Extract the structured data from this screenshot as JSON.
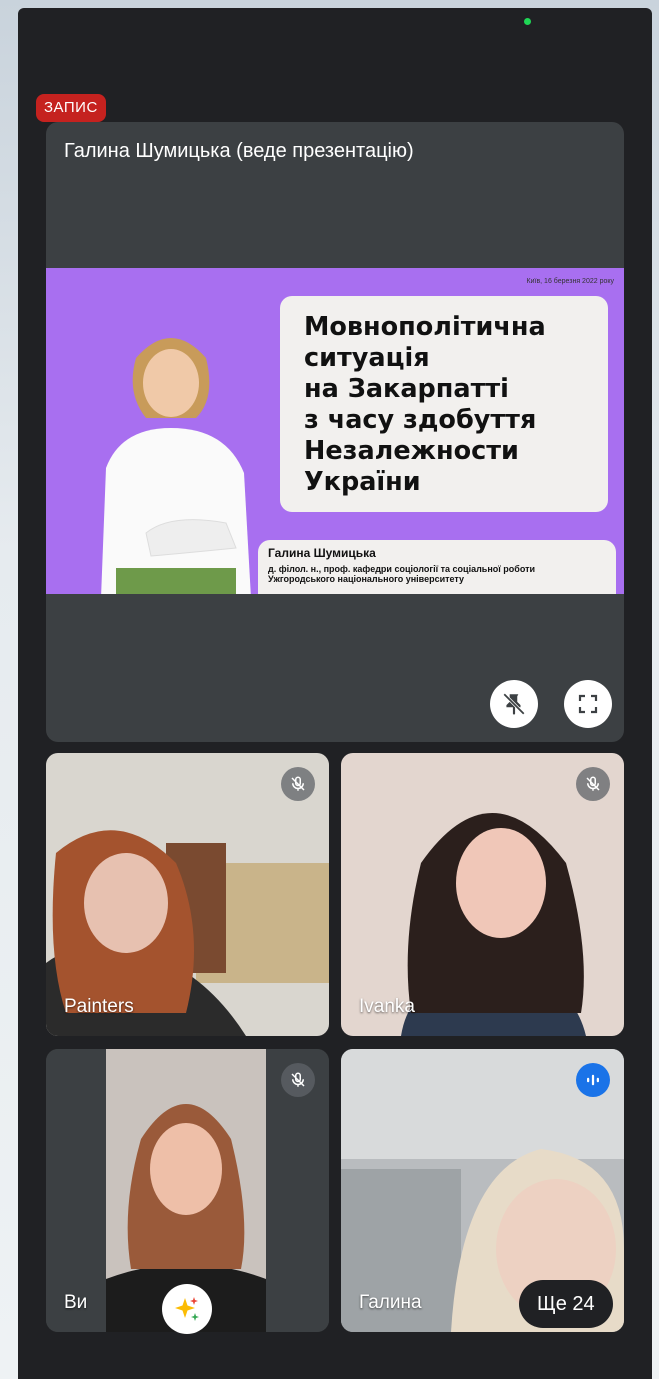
{
  "recording": {
    "label": "ЗАПИС"
  },
  "presentation": {
    "title": "Галина Шумицька (веде презентацію)",
    "slide": {
      "date": "Київ, 16 березня 2022 року",
      "heading": "Мовнополітична\nситуація\nна Закарпатті\nз часу здобуття\nНезалежности\nУкраїни",
      "speaker_name": "Галина Шумицька",
      "speaker_desc_line1": "д. філол. н., проф. кафедри соціології та соціальної роботи",
      "speaker_desc_line2": "Ужгородського національного університету"
    },
    "buttons": {
      "unpin_icon": "unpin-icon",
      "fullscreen_icon": "fullscreen-icon"
    }
  },
  "participants": [
    {
      "name": "Painters",
      "status_icon": "mic-off-icon"
    },
    {
      "name": "Ivanka",
      "status_icon": "mic-off-icon"
    },
    {
      "name": "Ви",
      "status_icon": "mic-off-icon"
    },
    {
      "name": "Галина",
      "status_icon": "speaking-icon"
    }
  ],
  "more": {
    "label": "Ще 24"
  },
  "colors": {
    "recording": "#c5221f",
    "speaking": "#1a73e8",
    "slide_bg": "#a86ff0",
    "surface": "#202124"
  }
}
